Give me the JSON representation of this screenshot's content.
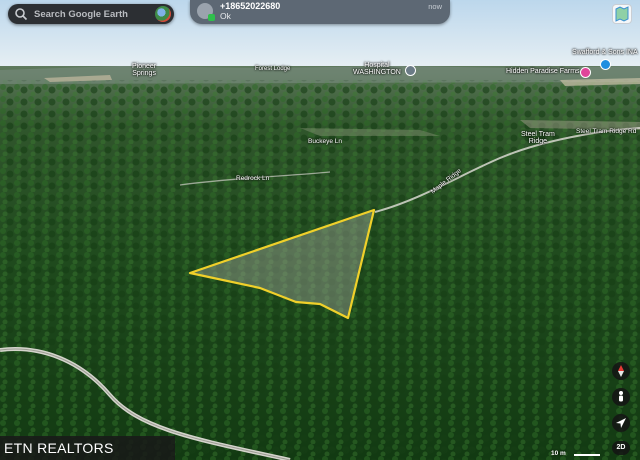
{
  "search": {
    "placeholder": "Search Google Earth"
  },
  "notification": {
    "title": "+18652022680",
    "message": "Ok",
    "time": "now"
  },
  "places": [
    {
      "name": "Pioneer\nSprings"
    },
    {
      "name": "Forest Lodge"
    },
    {
      "name": "Hospital\nWASHINGTON"
    },
    {
      "name": "Hidden Paradise Farms"
    },
    {
      "name": "Swafford & Sons INA"
    },
    {
      "name": "Steel Tram\nRidge"
    }
  ],
  "roads": [
    {
      "name": "Steel Tram Ridge Rd"
    },
    {
      "name": "Buckeye Ln"
    },
    {
      "name": "Redrock Ln"
    },
    {
      "name": "Maple Ridge"
    }
  ],
  "controls": {
    "view_mode": "2D",
    "scale": "10 m"
  },
  "brand": {
    "text": "ETN REALTORS"
  },
  "colors": {
    "boundary": "#f0d02a",
    "forest": "#1e4a1a",
    "sky": "#cfe3f2"
  }
}
